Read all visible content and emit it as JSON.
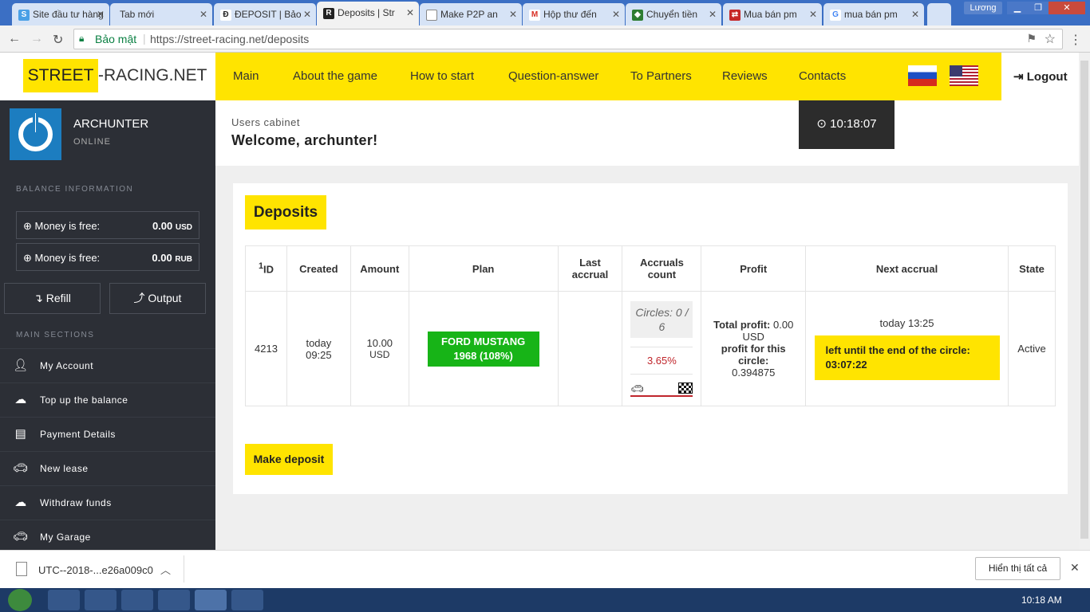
{
  "browser": {
    "tabs": [
      {
        "title": "Site đầu tư hàng",
        "icon_color": "#4aa0e6",
        "icon": "globe-icon",
        "active": false
      },
      {
        "title": "Tab mới",
        "icon_color": "#999999",
        "icon": "blank-icon",
        "active": false
      },
      {
        "title": "ĐEPOSIT | Bảo",
        "icon_color": "#222222",
        "icon": "d-icon",
        "active": false
      },
      {
        "title": "Deposits | Str",
        "icon_color": "#222222",
        "icon": "sr-icon",
        "active": true
      },
      {
        "title": "Make P2P an",
        "icon_color": "#888888",
        "icon": "doc-icon",
        "active": false
      },
      {
        "title": "Hộp thư đến",
        "icon_color": "#d93025",
        "icon": "gmail-icon",
        "active": false
      },
      {
        "title": "Chuyển tiền",
        "icon_color": "#2e7d32",
        "icon": "shield-icon",
        "active": false
      },
      {
        "title": "Mua bán pm",
        "icon_color": "#c62828",
        "icon": "exchange-icon",
        "active": false
      },
      {
        "title": "mua bán pm",
        "icon_color": "#4285f4",
        "icon": "google-icon",
        "active": false
      }
    ],
    "profile_name": "Lương",
    "security_label": "Bảo mật",
    "url": "https://street-racing.net/deposits"
  },
  "header": {
    "logo_box": "STREET",
    "logo_rest": "-RACING.NET",
    "nav": [
      "Main",
      "About the game",
      "How to start",
      "Question-answer",
      "To Partners",
      "Reviews",
      "Contacts"
    ],
    "logout": "Logout"
  },
  "sidebar": {
    "username": "ARCHUNTER",
    "status": "ONLINE",
    "balance_heading": "BALANCE INFORMATION",
    "balances": [
      {
        "label": "Money is free:",
        "amount": "0.00",
        "currency": "USD"
      },
      {
        "label": "Money is free:",
        "amount": "0.00",
        "currency": "RUB"
      }
    ],
    "refill": "Refill",
    "output": "Output",
    "sections_heading": "MAIN SECTIONS",
    "menu": [
      {
        "label": "My Account",
        "icon": "user-icon"
      },
      {
        "label": "Top up the balance",
        "icon": "cloud-upload-icon"
      },
      {
        "label": "Payment Details",
        "icon": "id-card-icon"
      },
      {
        "label": "New lease",
        "icon": "car-icon"
      },
      {
        "label": "Withdraw funds",
        "icon": "cloud-upload-icon"
      },
      {
        "label": "My Garage",
        "icon": "car-icon"
      }
    ]
  },
  "welcome": {
    "crumb": "Users cabinet",
    "title": "Welcome, archunter!",
    "clock": "10:18:07"
  },
  "deposits": {
    "title": "Deposits",
    "columns": {
      "id_sup": "1",
      "id": "ID",
      "created": "Created",
      "amount": "Amount",
      "plan": "Plan",
      "last_accrual": "Last accrual",
      "accruals_count": "Accruals count",
      "profit": "Profit",
      "next_accrual": "Next accrual",
      "state": "State"
    },
    "rows": [
      {
        "id": "4213",
        "created_day": "today",
        "created_time": "09:25",
        "amount": "10.00",
        "amount_currency": "USD",
        "plan": "FORD MUSTANG 1968 (108%)",
        "last_accrual": "",
        "circles": "Circles: 0 / 6",
        "accrual_pct": "3.65%",
        "total_profit_label": "Total profit:",
        "total_profit": "0.00 USD",
        "circle_profit_label": "profit for this circle:",
        "circle_profit": "0.394875",
        "next_accrual_time": "today 13:25",
        "circle_left_label": "left until the end of the circle:",
        "circle_left": "03:07:22",
        "state": "Active"
      }
    ],
    "make_deposit": "Make deposit"
  },
  "download_bar": {
    "file": "UTC--2018-...e26a009c0",
    "show_all": "Hiển thị tất cả"
  },
  "taskbar": {
    "time": "10:18 AM"
  },
  "colors": {
    "accent_yellow": "#ffe400",
    "sidebar_bg": "#2c2f36",
    "plan_green": "#17b417",
    "clock_bg": "#2c2c2c"
  }
}
